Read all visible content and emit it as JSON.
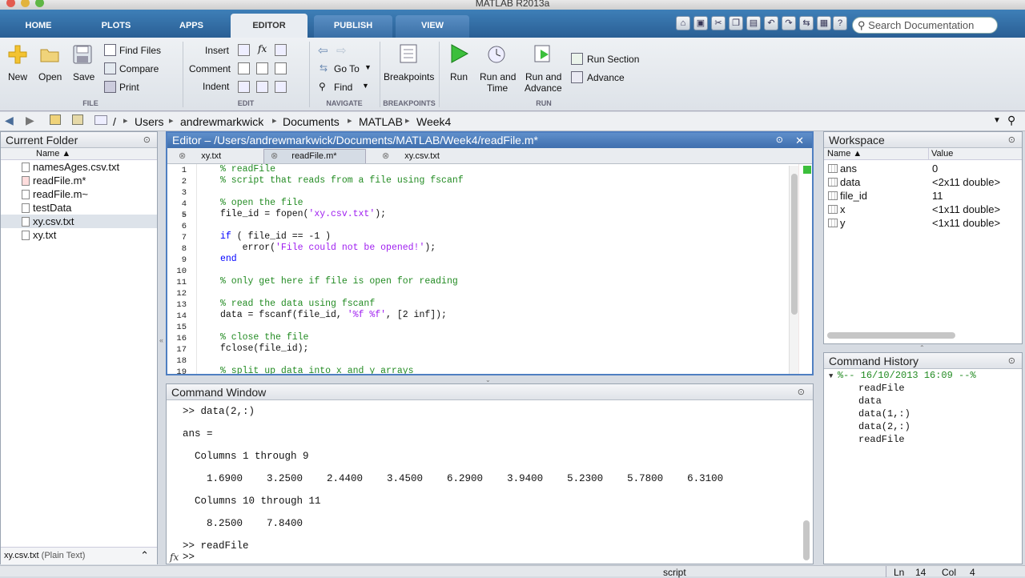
{
  "app_title": "MATLAB R2013a",
  "tabs": [
    "HOME",
    "PLOTS",
    "APPS",
    "EDITOR",
    "PUBLISH",
    "VIEW"
  ],
  "search_placeholder": "Search Documentation",
  "ribbon": {
    "file": {
      "new": "New",
      "open": "Open",
      "save": "Save",
      "find_files": "Find Files",
      "compare": "Compare",
      "print": "Print",
      "section": "FILE"
    },
    "edit": {
      "insert": "Insert",
      "comment": "Comment",
      "indent": "Indent",
      "section": "EDIT"
    },
    "navigate": {
      "goto": "Go To",
      "find": "Find",
      "section": "NAVIGATE"
    },
    "breakpoints": {
      "label": "Breakpoints",
      "section": "BREAKPOINTS"
    },
    "run": {
      "run": "Run",
      "run_and_time_1": "Run and",
      "run_and_time_2": "Time",
      "run_and_advance_1": "Run and",
      "run_and_advance_2": "Advance",
      "run_section": "Run Section",
      "advance": "Advance",
      "section": "RUN"
    }
  },
  "address": {
    "root": "/",
    "parts": [
      "Users",
      "andrewmarkwick",
      "Documents",
      "MATLAB",
      "Week4"
    ]
  },
  "current_folder": {
    "title": "Current Folder",
    "column": "Name ▲",
    "files": [
      "namesAges.csv.txt",
      "readFile.m*",
      "readFile.m~",
      "testData",
      "xy.csv.txt",
      "xy.txt"
    ],
    "status_name": "xy.csv.txt",
    "status_type": "(Plain Text)"
  },
  "editor": {
    "title": "Editor – /Users/andrewmarkwick/Documents/MATLAB/Week4/readFile.m*",
    "doc_tabs": [
      "xy.txt",
      "readFile.m*",
      "xy.csv.txt"
    ],
    "line_numbers": [
      "1",
      "2",
      "3",
      "4",
      "5",
      "6",
      "7",
      "8",
      "9",
      "10",
      "11",
      "12",
      "13",
      "14",
      "15",
      "16",
      "17",
      "18",
      "19"
    ],
    "lines": {
      "l1": "% readFile",
      "l2": "% script that reads from a file using fscanf",
      "l4": "% open the file",
      "l5a": "file_id = fopen(",
      "l5s": "'xy.csv.txt'",
      "l5b": ");",
      "l7a": "if",
      "l7b": " ( file_id == -1 )",
      "l8a": "    error(",
      "l8s": "'File could not be opened!'",
      "l8b": ");",
      "l9": "end",
      "l11": "% only get here if file is open for reading",
      "l13": "% read the data using fscanf",
      "l14a": "data = fscanf(file_id, ",
      "l14s": "'%f %f'",
      "l14b": ", [2 inf]);",
      "l16": "% close the file",
      "l17": "fclose(file_id);",
      "l19": "% split up data into x and y arrays"
    }
  },
  "command_window": {
    "title": "Command Window",
    "lines": [
      ">> data(2,:)",
      "",
      "ans =",
      "",
      "  Columns 1 through 9",
      "",
      "    1.6900    3.2500    2.4400    3.4500    6.2900    3.9400    5.2300    5.7800    6.3100",
      "",
      "  Columns 10 through 11",
      "",
      "    8.2500    7.8400",
      "",
      ">> readFile",
      ">> "
    ],
    "fx": "fx"
  },
  "workspace": {
    "title": "Workspace",
    "col_name": "Name ▲",
    "col_value": "Value",
    "vars": [
      {
        "name": "ans",
        "value": "0"
      },
      {
        "name": "data",
        "value": "<2x11 double>"
      },
      {
        "name": "file_id",
        "value": "11"
      },
      {
        "name": "x",
        "value": "<1x11 double>"
      },
      {
        "name": "y",
        "value": "<1x11 double>"
      }
    ]
  },
  "history": {
    "title": "Command History",
    "session": "%-- 16/10/2013 16:09 --%",
    "items": [
      "readFile",
      "data",
      "data(1,:)",
      "data(2,:)",
      "readFile"
    ]
  },
  "statusbar": {
    "mode": "script",
    "ln_label": "Ln",
    "ln": "14",
    "col_label": "Col",
    "col": "4"
  }
}
